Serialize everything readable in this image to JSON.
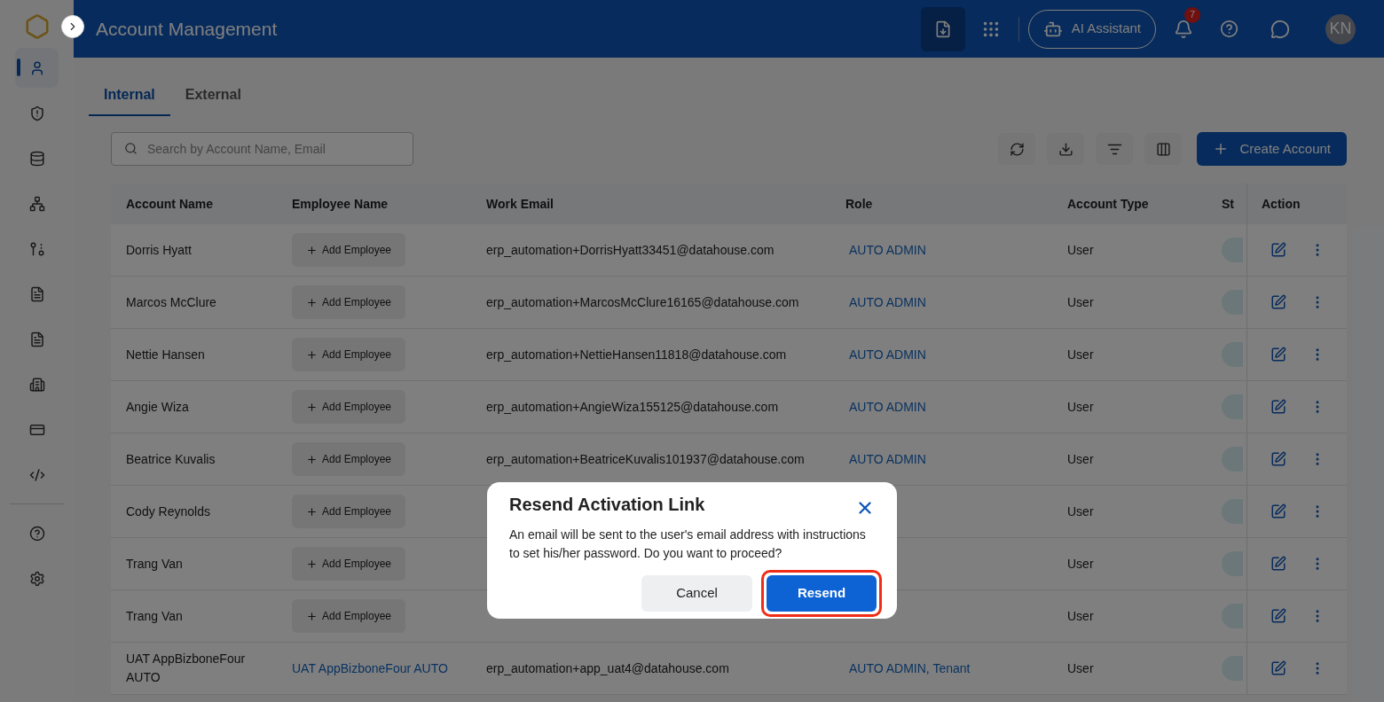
{
  "header": {
    "title": "Account Management",
    "assistant": "AI Assistant",
    "notifications": "7",
    "avatar": "KN"
  },
  "sidebar": {
    "items": [
      {
        "selected": true
      },
      {
        "selected": false
      },
      {
        "selected": false
      },
      {
        "selected": false
      },
      {
        "selected": false
      },
      {
        "selected": false
      },
      {
        "selected": false
      },
      {
        "selected": false
      },
      {
        "selected": false
      },
      {
        "selected": false
      }
    ]
  },
  "tabs": [
    {
      "label": "Internal",
      "selected": true
    },
    {
      "label": "External",
      "selected": false
    }
  ],
  "search": {
    "placeholder": "Search by Account Name, Email"
  },
  "create_button": "Create Account",
  "table": {
    "columns": [
      "Account Name",
      "Employee Name",
      "Work Email",
      "Role",
      "Account Type",
      "St",
      "Action"
    ],
    "rows": [
      {
        "name": "Dorris Hyatt",
        "employee": {
          "kind": "button",
          "text": "Add Employee"
        },
        "email": "erp_automation+DorrisHyatt33451@datahouse.com",
        "role": "AUTO ADMIN",
        "type": "User"
      },
      {
        "name": "Marcos McClure",
        "employee": {
          "kind": "button",
          "text": "Add Employee"
        },
        "email": "erp_automation+MarcosMcClure16165@datahouse.com",
        "role": "AUTO ADMIN",
        "type": "User"
      },
      {
        "name": "Nettie Hansen",
        "employee": {
          "kind": "button",
          "text": "Add Employee"
        },
        "email": "erp_automation+NettieHansen11818@datahouse.com",
        "role": "AUTO ADMIN",
        "type": "User"
      },
      {
        "name": "Angie Wiza",
        "employee": {
          "kind": "button",
          "text": "Add Employee"
        },
        "email": "erp_automation+AngieWiza155125@datahouse.com",
        "role": "AUTO ADMIN",
        "type": "User"
      },
      {
        "name": "Beatrice Kuvalis",
        "employee": {
          "kind": "button",
          "text": "Add Employee"
        },
        "email": "erp_automation+BeatriceKuvalis101937@datahouse.com",
        "role": "AUTO ADMIN",
        "type": "User"
      },
      {
        "name": "Cody Reynolds",
        "employee": {
          "kind": "button",
          "text": "Add Employee"
        },
        "type": "User"
      },
      {
        "name": "Trang Van",
        "employee": {
          "kind": "button",
          "text": "Add Employee"
        },
        "type": "User"
      },
      {
        "name": "Trang Van",
        "employee": {
          "kind": "button",
          "text": "Add Employee"
        },
        "type": "User"
      },
      {
        "name": "UAT AppBizboneFour AUTO",
        "employee": {
          "kind": "link",
          "text": "UAT AppBizboneFour AUTO"
        },
        "email": "erp_automation+app_uat4@datahouse.com",
        "role": "AUTO ADMIN, Tenant",
        "type": "User"
      }
    ]
  },
  "dialog": {
    "title": "Resend Activation Link",
    "message": "An email will be sent to the user's email address with instructions to set his/her password. Do you want to proceed?",
    "cancel": "Cancel",
    "confirm": "Resend"
  }
}
